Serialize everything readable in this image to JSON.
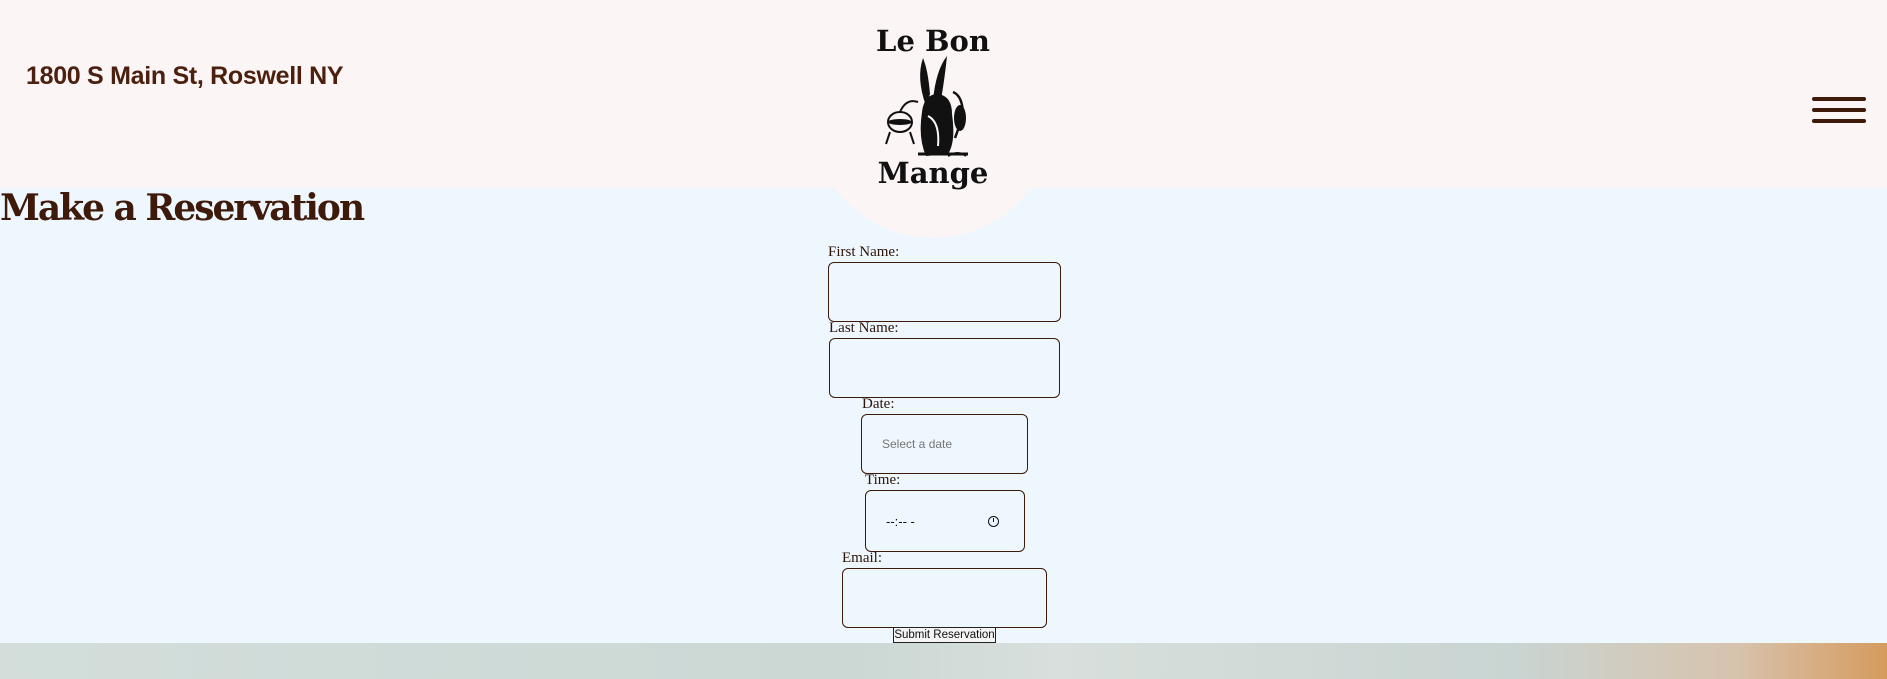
{
  "header": {
    "address": "1800 S Main St, Roswell NY",
    "logo_line1": "Le Bon",
    "logo_line2": "Mange"
  },
  "main": {
    "title": "Make a Reservation"
  },
  "form": {
    "first_name_label": "First Name:",
    "last_name_label": "Last Name:",
    "date_label": "Date:",
    "date_placeholder": "Select a date",
    "time_label": "Time:",
    "time_placeholder": "--:-- -",
    "email_label": "Email:",
    "submit_label": "Submit Reservation"
  },
  "icons": {
    "menu": "hamburger-menu-icon",
    "time": "clock-icon",
    "logo": "rabbit-chef-illustration"
  },
  "colors": {
    "header_bg": "#fbf5f5",
    "page_bg": "#eff7fe",
    "brand_brown": "#3d1a0a"
  }
}
